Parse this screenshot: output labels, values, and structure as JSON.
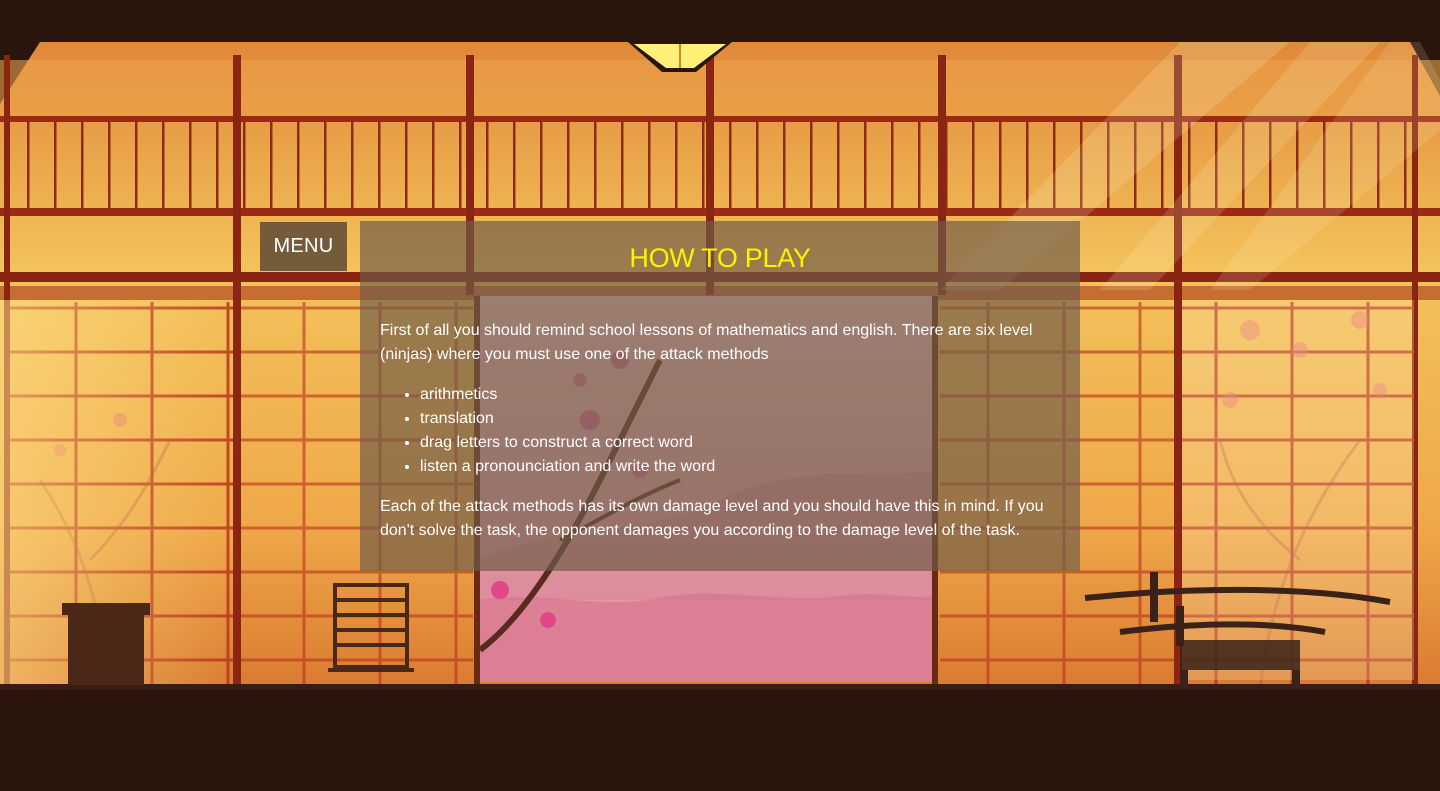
{
  "menu": {
    "label": "MENU"
  },
  "panel": {
    "title": "HOW TO PLAY",
    "intro": "First of all you should remind school lessons of mathematics and english. There are six level (ninjas) where you must use one of the attack methods",
    "methods": [
      "arithmetics",
      "translation",
      "drag letters to construct a correct word",
      "listen a pronounciation and write the word"
    ],
    "outro": "Each of the attack methods has its own damage level and you should have this in mind. If you don't solve the task, the opponent damages you according to the damage level of the task."
  },
  "colors": {
    "title": "#fff200",
    "floor": "#2a150c",
    "wall_glow": "#f3c25a",
    "frame": "#9a2a15"
  },
  "scene": {
    "icons": [
      "lamp-icon",
      "cherry-blossom-icon",
      "chair-icon",
      "box-stand-icon",
      "katana-rack-icon"
    ]
  }
}
